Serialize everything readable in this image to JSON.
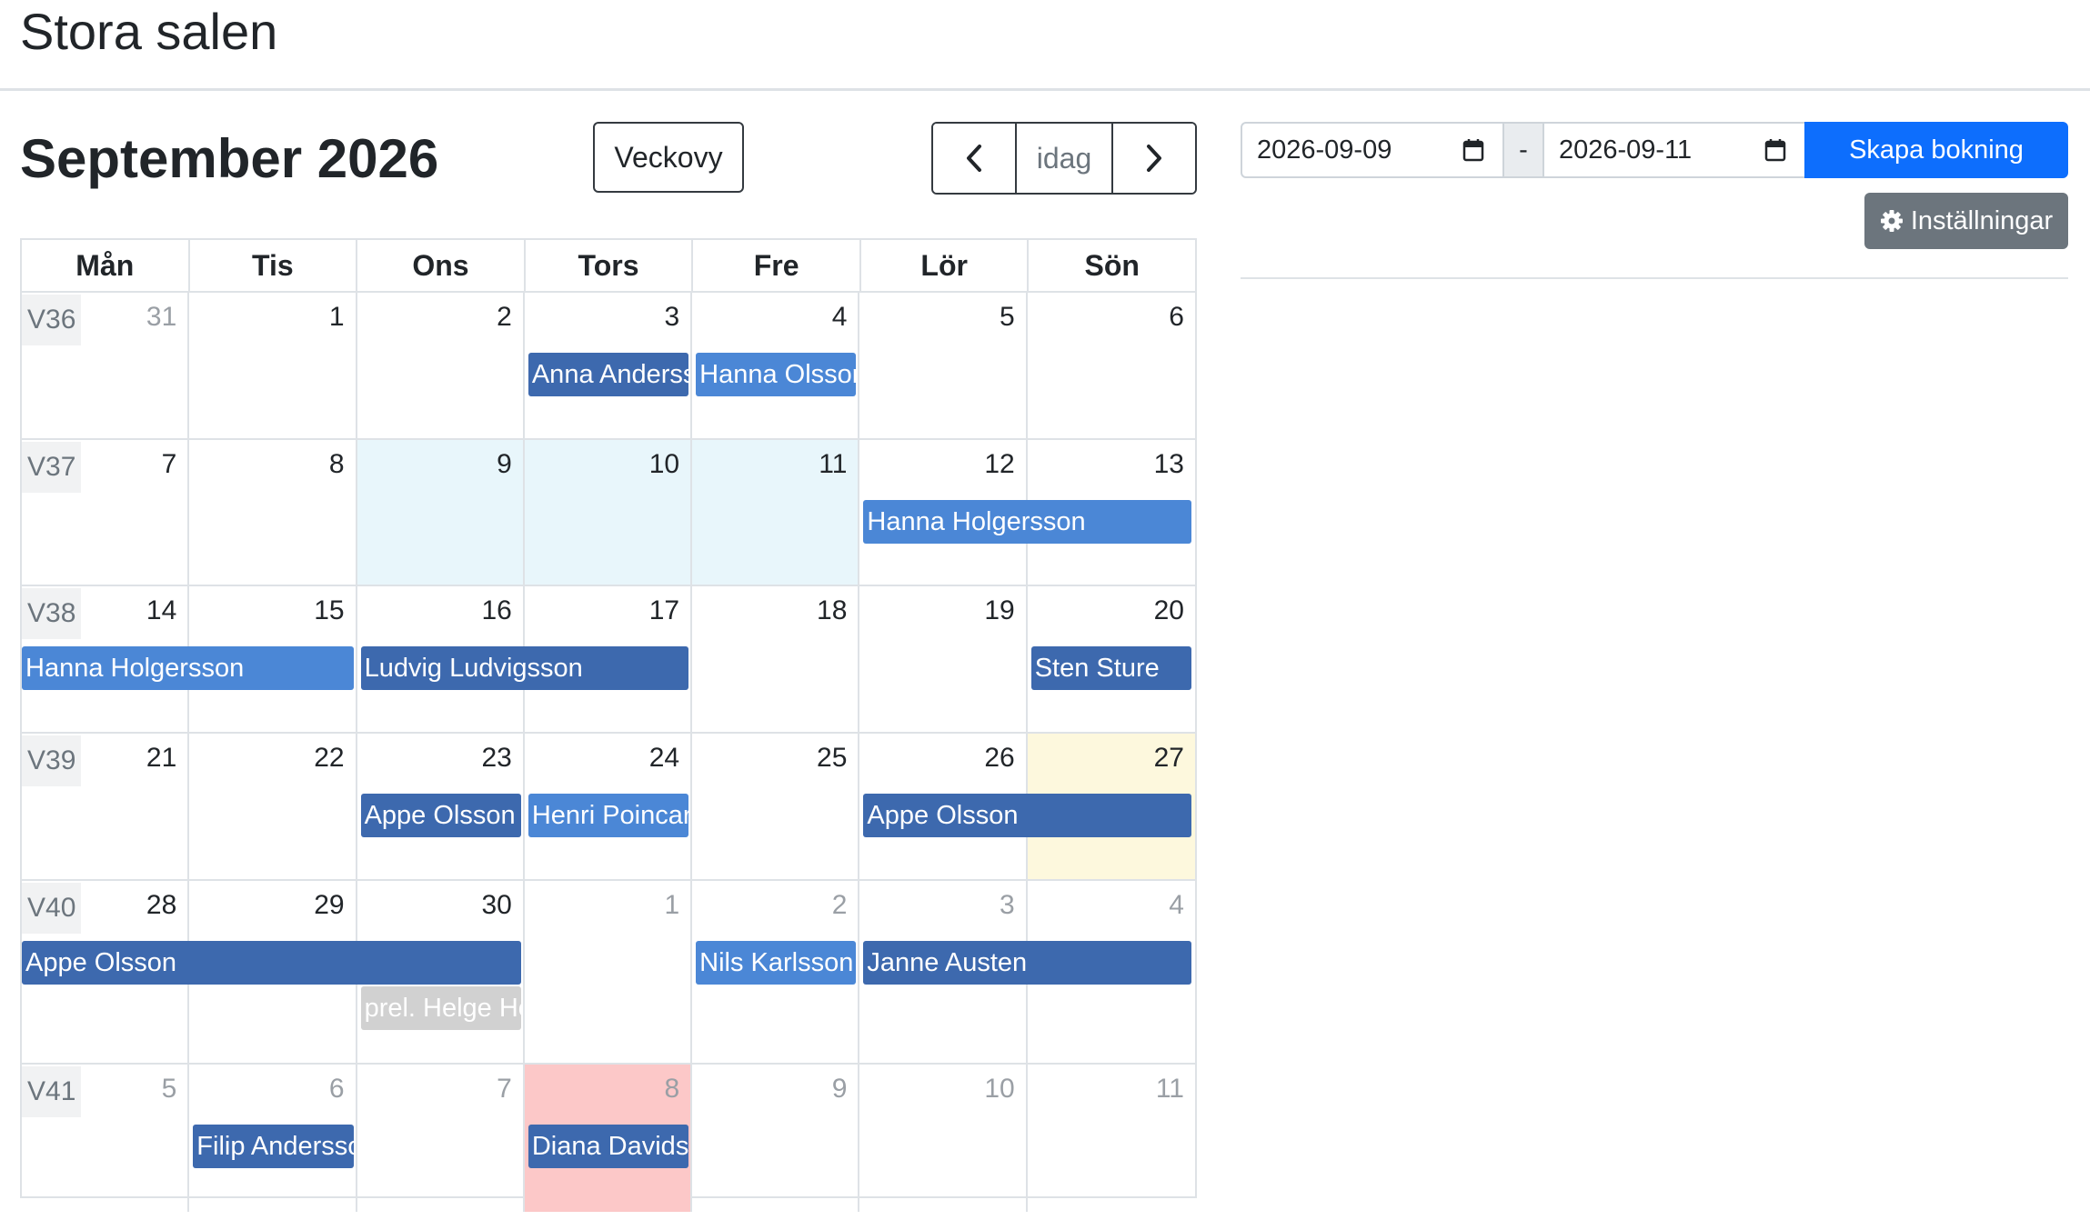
{
  "page_title": "Stora salen",
  "month_title": "September 2026",
  "toolbar": {
    "week_view_label": "Veckovy",
    "today_label": "idag",
    "prev_icon": "chevron-left-icon",
    "next_icon": "chevron-right-icon"
  },
  "booking_form": {
    "date_from": "2026-09-09",
    "separator": "-",
    "date_to": "2026-09-11",
    "create_label": "Skapa bokning",
    "settings_label": "Inställningar",
    "settings_icon": "gear-icon",
    "calendar_icon": "calendar-icon"
  },
  "weekdays": [
    "Mån",
    "Tis",
    "Ons",
    "Tors",
    "Fre",
    "Lör",
    "Sön"
  ],
  "weeks": [
    {
      "label": "V36",
      "days": [
        {
          "n": "31",
          "other": true
        },
        {
          "n": "1"
        },
        {
          "n": "2"
        },
        {
          "n": "3"
        },
        {
          "n": "4"
        },
        {
          "n": "5"
        },
        {
          "n": "6"
        }
      ],
      "events": [
        {
          "name": "Anna Anderss",
          "start": 3,
          "span": 1,
          "style": "dark"
        },
        {
          "name": "Hanna Olsson",
          "start": 4,
          "span": 1,
          "style": "light"
        }
      ]
    },
    {
      "label": "V37",
      "days": [
        {
          "n": "7"
        },
        {
          "n": "8"
        },
        {
          "n": "9",
          "bg": "sel"
        },
        {
          "n": "10",
          "bg": "sel"
        },
        {
          "n": "11",
          "bg": "sel"
        },
        {
          "n": "12"
        },
        {
          "n": "13"
        }
      ],
      "events": [
        {
          "name": "Hanna Holgersson",
          "start": 5,
          "span": 2,
          "style": "light"
        }
      ]
    },
    {
      "label": "V38",
      "days": [
        {
          "n": "14"
        },
        {
          "n": "15"
        },
        {
          "n": "16"
        },
        {
          "n": "17"
        },
        {
          "n": "18"
        },
        {
          "n": "19"
        },
        {
          "n": "20"
        }
      ],
      "events": [
        {
          "name": "Hanna Holgersson",
          "start": 0,
          "span": 2,
          "style": "light"
        },
        {
          "name": "Ludvig Ludvigsson",
          "start": 2,
          "span": 2,
          "style": "dark"
        },
        {
          "name": "Sten Sture",
          "start": 6,
          "span": 1,
          "style": "dark"
        }
      ]
    },
    {
      "label": "V39",
      "days": [
        {
          "n": "21"
        },
        {
          "n": "22"
        },
        {
          "n": "23"
        },
        {
          "n": "24"
        },
        {
          "n": "25"
        },
        {
          "n": "26"
        },
        {
          "n": "27",
          "bg": "today"
        }
      ],
      "events": [
        {
          "name": "Appe Olsson",
          "start": 2,
          "span": 1,
          "style": "dark"
        },
        {
          "name": "Henri Poincar",
          "start": 3,
          "span": 1,
          "style": "light"
        },
        {
          "name": "Appe Olsson",
          "start": 5,
          "span": 2,
          "style": "dark"
        }
      ]
    },
    {
      "label": "V40",
      "days": [
        {
          "n": "28"
        },
        {
          "n": "29"
        },
        {
          "n": "30"
        },
        {
          "n": "1",
          "other": true
        },
        {
          "n": "2",
          "other": true
        },
        {
          "n": "3",
          "other": true
        },
        {
          "n": "4",
          "other": true
        }
      ],
      "events": [
        {
          "name": "Appe Olsson",
          "start": 0,
          "span": 3,
          "style": "dark"
        },
        {
          "name": "Nils Karlsson",
          "start": 4,
          "span": 1,
          "style": "light"
        },
        {
          "name": "Janne Austen",
          "start": 5,
          "span": 2,
          "style": "dark"
        },
        {
          "name": "prel. Helge Ho",
          "start": 2,
          "span": 1,
          "style": "prel",
          "lane": 1
        }
      ]
    },
    {
      "label": "V41",
      "days": [
        {
          "n": "5",
          "other": true
        },
        {
          "n": "6",
          "other": true
        },
        {
          "n": "7",
          "other": true
        },
        {
          "n": "8",
          "other": true,
          "bg": "holiday"
        },
        {
          "n": "9",
          "other": true
        },
        {
          "n": "10",
          "other": true
        },
        {
          "n": "11",
          "other": true
        }
      ],
      "events": [
        {
          "name": "Filip Andersso",
          "start": 1,
          "span": 1,
          "style": "dark"
        },
        {
          "name": "Diana Davidss",
          "start": 3,
          "span": 1,
          "style": "dark"
        }
      ]
    }
  ]
}
